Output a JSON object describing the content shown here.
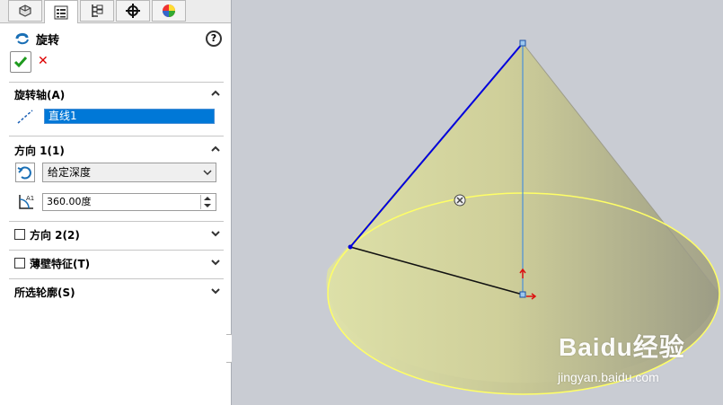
{
  "panel": {
    "tabs": [
      {
        "icon": "feature-manager-icon",
        "active": false
      },
      {
        "icon": "property-manager-icon",
        "active": true
      },
      {
        "icon": "configuration-manager-icon",
        "active": false
      },
      {
        "icon": "dimxpert-icon",
        "active": false
      },
      {
        "icon": "display-manager-icon",
        "active": false
      }
    ],
    "feature_title": "旋转",
    "help_label": "?",
    "ok_label": "✔",
    "cancel_label": "✕"
  },
  "sections": {
    "axis": {
      "title": "旋转轴(A)",
      "value": "直线1"
    },
    "direction1": {
      "title": "方向 1(1)",
      "end_condition": "给定深度",
      "angle": "360.00度"
    },
    "direction2": {
      "title": "方向 2(2)",
      "checked": false
    },
    "thin": {
      "title": "薄壁特征(T)",
      "checked": false
    },
    "contours": {
      "title": "所选轮廓(S)"
    }
  },
  "watermark": {
    "brand": "Baidu经验",
    "url": "jingyan.baidu.com"
  },
  "colors": {
    "accent": "#0078d7",
    "profile_line": "#0000dd",
    "axis_line": "#4a90d9",
    "edge": "#ffff66",
    "cone": "#cfcf9a"
  }
}
